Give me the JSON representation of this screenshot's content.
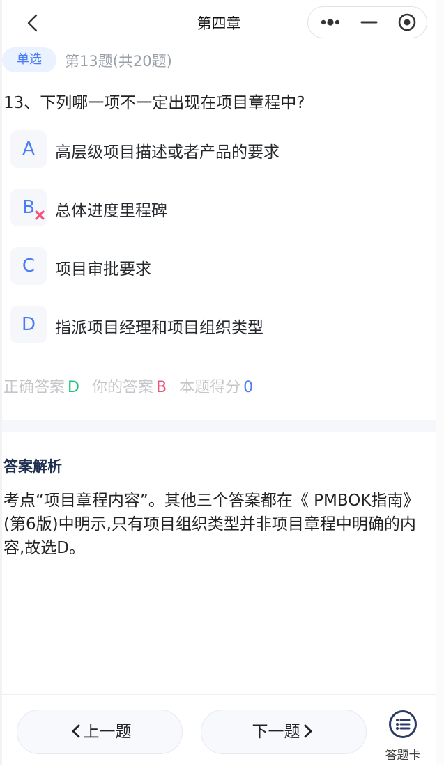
{
  "nav": {
    "title": "第四章"
  },
  "question": {
    "type_badge": "单选",
    "progress": "第13题(共20题)",
    "text": "13、下列哪一项不一定出现在项目章程中?",
    "options": [
      {
        "letter": "A",
        "text": "高层级项目描述或者产品的要求"
      },
      {
        "letter": "B",
        "text": "总体进度里程碑",
        "selected_wrong": true
      },
      {
        "letter": "C",
        "text": "项目审批要求"
      },
      {
        "letter": "D",
        "text": "指派项目经理和项目组织类型"
      }
    ]
  },
  "result": {
    "correct_label": "正确答案",
    "correct_value": "D",
    "your_label": "你的答案",
    "your_value": "B",
    "score_label": "本题得分",
    "score_value": "0"
  },
  "analysis": {
    "title": "答案解析",
    "text": "考点“项目章程内容”。其他三个答案都在《 PMBOK指南》(第6版)中明示,只有项目组织类型并非项目章程中明确的内容,故选D。"
  },
  "footer": {
    "prev_label": "上一题",
    "next_label": "下一题",
    "card_label": "答题卡"
  },
  "colors": {
    "accent": "#4a7cf6",
    "correct": "#19c27a",
    "wrong": "#f0527a"
  }
}
